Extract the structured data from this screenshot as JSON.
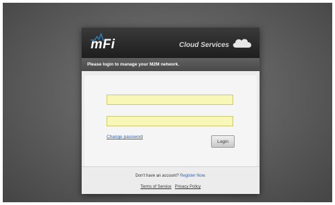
{
  "header": {
    "logo_text": "mFi",
    "service_label": "Cloud Services"
  },
  "subheader": {
    "prompt": "Please login to manage your M2M network."
  },
  "form": {
    "username_value": "",
    "password_value": "",
    "change_password_label": "Change password",
    "login_label": "Login"
  },
  "footer": {
    "no_account_text": "Don't have an account?",
    "register_label": "Register Now.",
    "terms_label": "Terms of Service",
    "privacy_label": "Privacy Policy"
  },
  "colors": {
    "field_background": "#f9f7b8",
    "link": "#2c62b6",
    "header_dark": "#1e1e1e"
  }
}
